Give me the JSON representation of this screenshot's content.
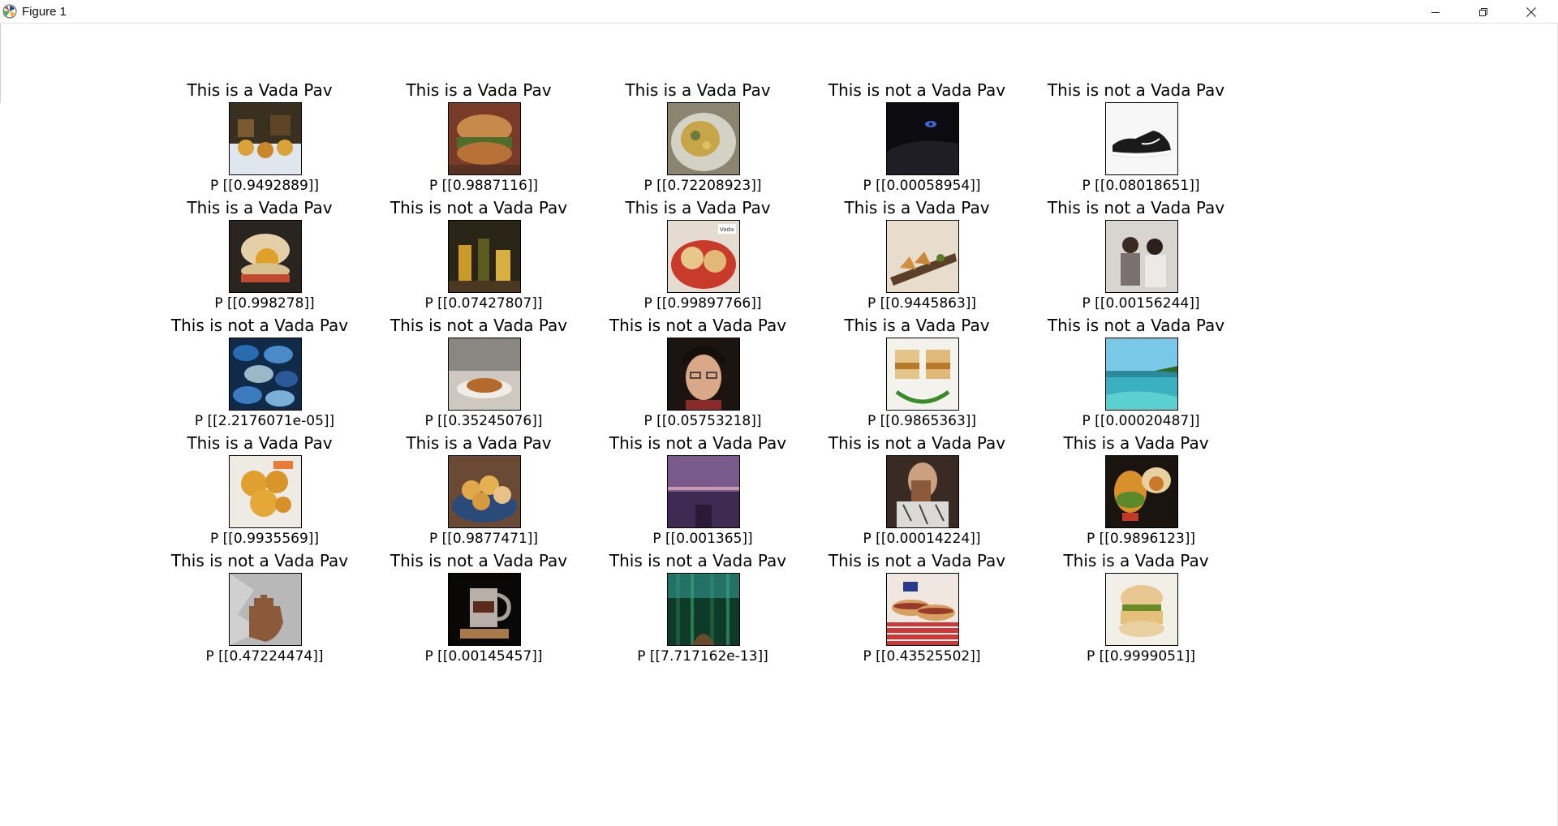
{
  "window": {
    "title": "Figure 1",
    "app_icon": "matplotlib-icon",
    "controls": [
      "minimize-icon",
      "restore-icon",
      "close-icon"
    ]
  },
  "grid": [
    {
      "title": "This is a Vada Pav",
      "prob": "P [[0.9492889]]",
      "thumb": "vada-pav-platter"
    },
    {
      "title": "This is a Vada Pav",
      "prob": "P [[0.9887116]]",
      "thumb": "vada-pav-burger"
    },
    {
      "title": "This is a Vada Pav",
      "prob": "P [[0.72208923]]",
      "thumb": "vada-pav-plate"
    },
    {
      "title": "This is not a Vada Pav",
      "prob": "P [[0.00058954]]",
      "thumb": "dark-animal-eye"
    },
    {
      "title": "This is not a Vada Pav",
      "prob": "P [[0.08018651]]",
      "thumb": "sneaker-shoe"
    },
    {
      "title": "This is a Vada Pav",
      "prob": "P [[0.998278]]",
      "thumb": "vada-pav-single"
    },
    {
      "title": "This is not a Vada Pav",
      "prob": "P [[0.07427807]]",
      "thumb": "bar-drinks"
    },
    {
      "title": "This is a Vada Pav",
      "prob": "P [[0.99897766]]",
      "thumb": "vada-pav-red-plate"
    },
    {
      "title": "This is a Vada Pav",
      "prob": "P [[0.9445863]]",
      "thumb": "snack-board"
    },
    {
      "title": "This is not a Vada Pav",
      "prob": "P [[0.00156244]]",
      "thumb": "people-photo"
    },
    {
      "title": "This is not a Vada Pav",
      "prob": "P [[2.2176071e-05]]",
      "thumb": "blue-stones"
    },
    {
      "title": "This is not a Vada Pav",
      "prob": "P [[0.35245076]]",
      "thumb": "cafe-pastry"
    },
    {
      "title": "This is not a Vada Pav",
      "prob": "P [[0.05753218]]",
      "thumb": "portrait-glasses"
    },
    {
      "title": "This is a Vada Pav",
      "prob": "P [[0.9865363]]",
      "thumb": "vada-pav-chutney"
    },
    {
      "title": "This is not a Vada Pav",
      "prob": "P [[0.00020487]]",
      "thumb": "tropical-beach"
    },
    {
      "title": "This is a Vada Pav",
      "prob": "P [[0.9935569]]",
      "thumb": "fried-balls"
    },
    {
      "title": "This is a Vada Pav",
      "prob": "P [[0.9877471]]",
      "thumb": "vada-bowl"
    },
    {
      "title": "This is not a Vada Pav",
      "prob": "P [[0.001365]]",
      "thumb": "purple-sunset-pier"
    },
    {
      "title": "This is not a Vada Pav",
      "prob": "P [[0.00014224]]",
      "thumb": "person-drinking"
    },
    {
      "title": "This is a Vada Pav",
      "prob": "P [[0.9896123]]",
      "thumb": "vada-pav-dark"
    },
    {
      "title": "This is not a Vada Pav",
      "prob": "P [[0.47224474]]",
      "thumb": "hand-foil"
    },
    {
      "title": "This is not a Vada Pav",
      "prob": "P [[0.00145457]]",
      "thumb": "beer-mug"
    },
    {
      "title": "This is not a Vada Pav",
      "prob": "P [[7.717162e-13]]",
      "thumb": "green-forest"
    },
    {
      "title": "This is not a Vada Pav",
      "prob": "P [[0.43525502]]",
      "thumb": "hot-dogs"
    },
    {
      "title": "This is a Vada Pav",
      "prob": "P [[0.9999051]]",
      "thumb": "vada-pav-sandwich"
    }
  ]
}
